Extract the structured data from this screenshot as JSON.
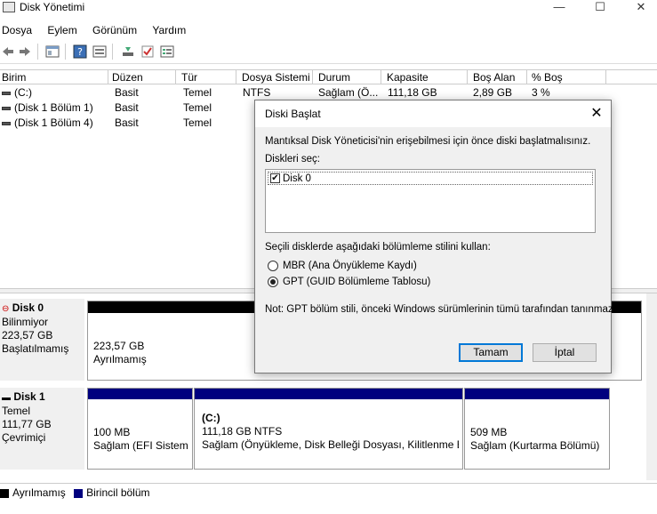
{
  "window": {
    "title": "Disk Yönetimi",
    "controls": [
      "—",
      "☐",
      "✕"
    ]
  },
  "menu": [
    "Dosya",
    "Eylem",
    "Görünüm",
    "Yardım"
  ],
  "list": {
    "columns": [
      "Birim",
      "Düzen",
      "Tür",
      "Dosya Sistemi",
      "Durum",
      "Kapasite",
      "Boş Alan",
      "% Boş"
    ],
    "rows": [
      [
        "(C:)",
        "Basit",
        "Temel",
        "NTFS",
        "Sağlam (Ö...",
        "111,18 GB",
        "2,89 GB",
        "3 %"
      ],
      [
        "(Disk 1 Bölüm 1)",
        "Basit",
        "Temel",
        "",
        "",
        "",
        "",
        ""
      ],
      [
        "(Disk 1 Bölüm 4)",
        "Basit",
        "Temel",
        "",
        "",
        "",
        "",
        ""
      ]
    ]
  },
  "disks": [
    {
      "name": "Disk 0",
      "type": "Bilinmiyor",
      "size": "223,57 GB",
      "state": "Başlatılmamış",
      "partitions": [
        {
          "size": "223,57 GB",
          "status": "Ayrılmamış",
          "color": "#000000"
        }
      ]
    },
    {
      "name": "Disk 1",
      "type": "Temel",
      "size": "111,77 GB",
      "state": "Çevrimiçi",
      "partitions": [
        {
          "label": "",
          "size": "100 MB",
          "status": "Sağlam (EFI Sistem Bölümü)",
          "color": "#00007f"
        },
        {
          "label": "(C:)",
          "size": "111,18 GB NTFS",
          "status": "Sağlam (Önyükleme, Disk Belleği Dosyası, Kilitlenme Bilgi Dökümü)",
          "color": "#00007f"
        },
        {
          "label": "",
          "size": "509 MB",
          "status": "Sağlam (Kurtarma Bölümü)",
          "color": "#00007f"
        }
      ]
    }
  ],
  "legend": [
    {
      "label": "Ayrılmamış",
      "color": "#000000"
    },
    {
      "label": "Birincil bölüm",
      "color": "#00007f"
    }
  ],
  "dialog": {
    "title": "Diski Başlat",
    "intro": "Mantıksal Disk Yöneticisi'nin erişebilmesi için önce diski başlatmalısınız.",
    "select_label": "Diskleri seç:",
    "disk_item": "Disk 0",
    "disk_checked": true,
    "style_label": "Seçili disklerde aşağıdaki bölümleme stilini kullan:",
    "option_mbr": "MBR (Ana Önyükleme Kaydı)",
    "option_gpt": "GPT (GUID Bölümleme Tablosu)",
    "selected": "gpt",
    "note": "Not: GPT bölüm stili, önceki Windows sürümlerinin tümü tarafından tanınmaz.",
    "ok": "Tamam",
    "cancel": "İptal"
  }
}
